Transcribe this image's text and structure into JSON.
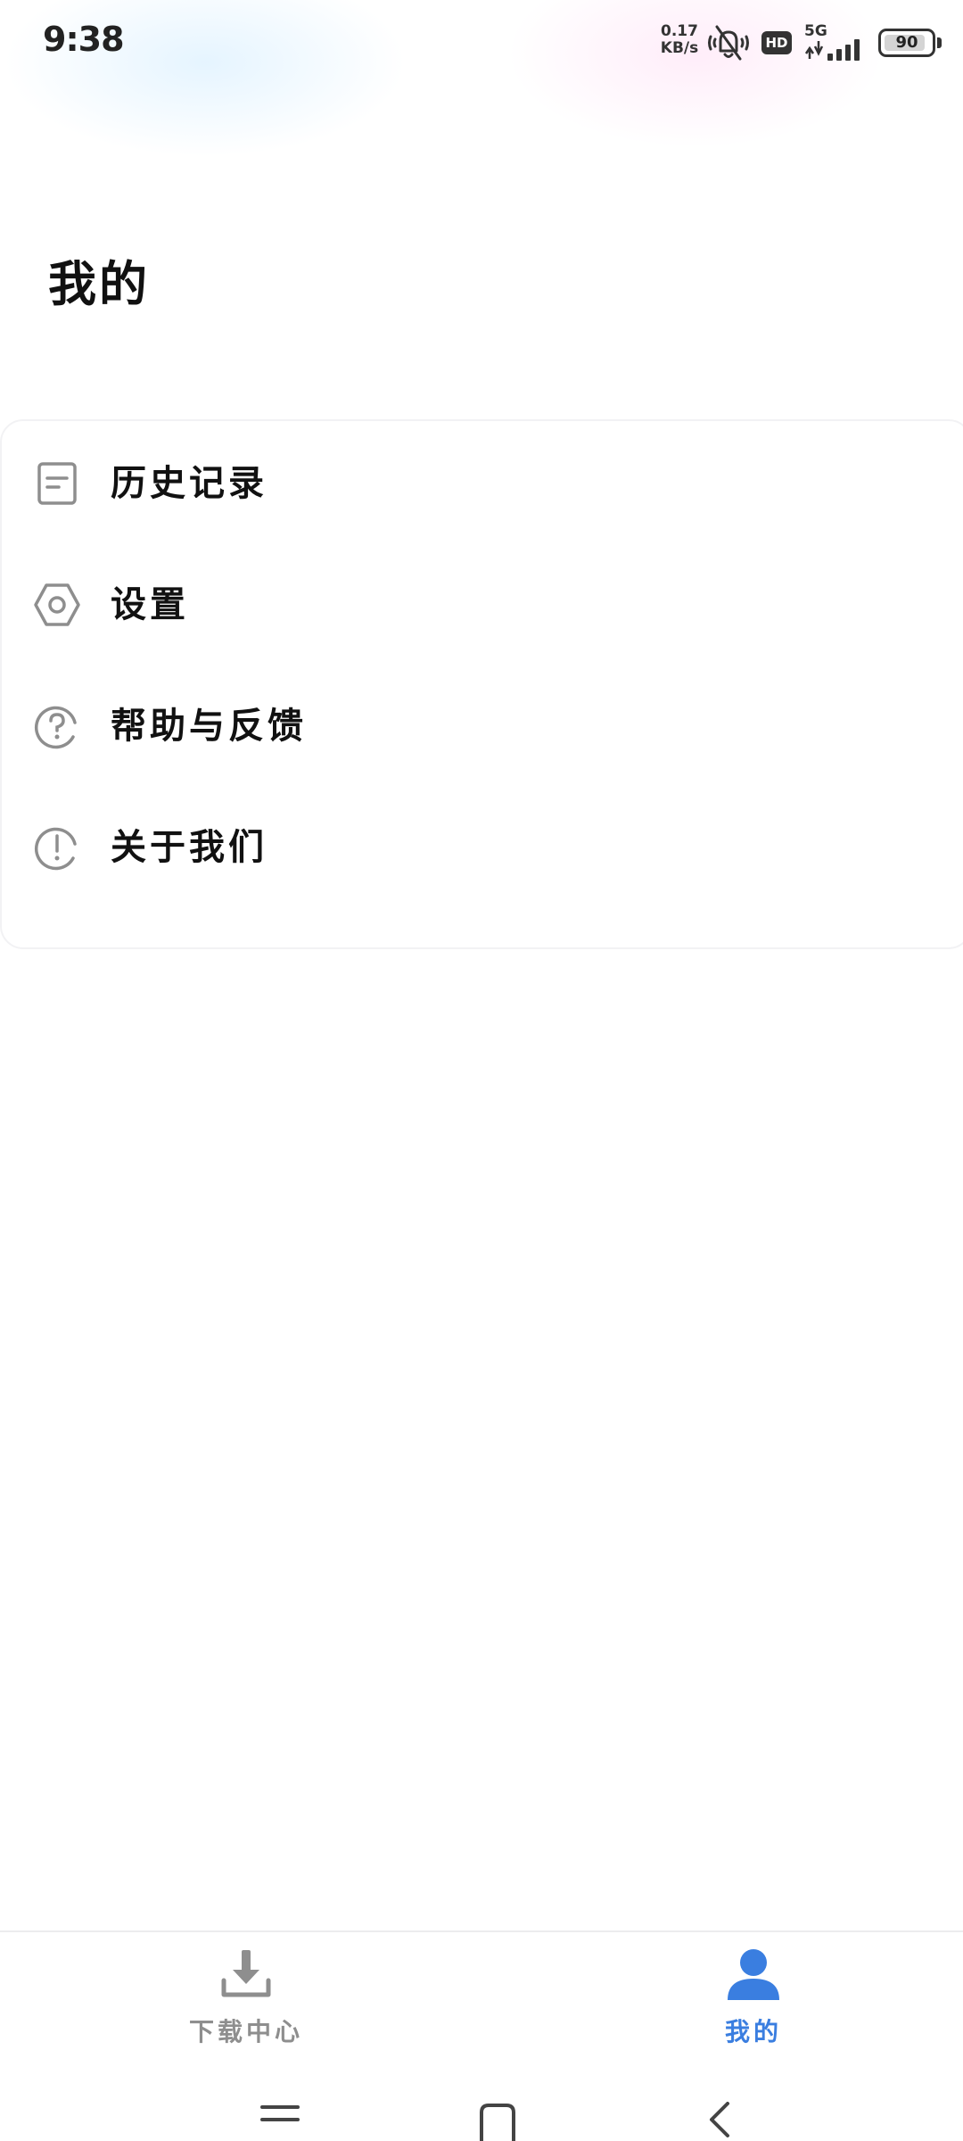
{
  "status_bar": {
    "time": "9:38",
    "net_speed_value": "0.17",
    "net_speed_unit": "KB/s",
    "hd_label": "HD",
    "network_type": "5G",
    "battery_level": "90",
    "icons": [
      "bell-muted-icon",
      "signal-icon",
      "battery-icon"
    ]
  },
  "page": {
    "title": "我的"
  },
  "menu": {
    "items": [
      {
        "label": "历史记录",
        "icon": "document-icon"
      },
      {
        "label": "设置",
        "icon": "settings-hexagon-icon"
      },
      {
        "label": "帮助与反馈",
        "icon": "help-circle-icon"
      },
      {
        "label": "关于我们",
        "icon": "info-circle-icon"
      }
    ]
  },
  "bottom_nav": {
    "tabs": [
      {
        "label": "下载中心",
        "icon": "download-icon",
        "active": false
      },
      {
        "label": "我的",
        "icon": "person-icon",
        "active": true
      }
    ]
  },
  "system_nav": {
    "icons": [
      "menu-lines-icon",
      "home-square-icon",
      "back-chevron-icon"
    ]
  },
  "colors": {
    "accent": "#3a7ee0",
    "icon_gray": "#8e8e8e",
    "text_primary": "#111111"
  }
}
